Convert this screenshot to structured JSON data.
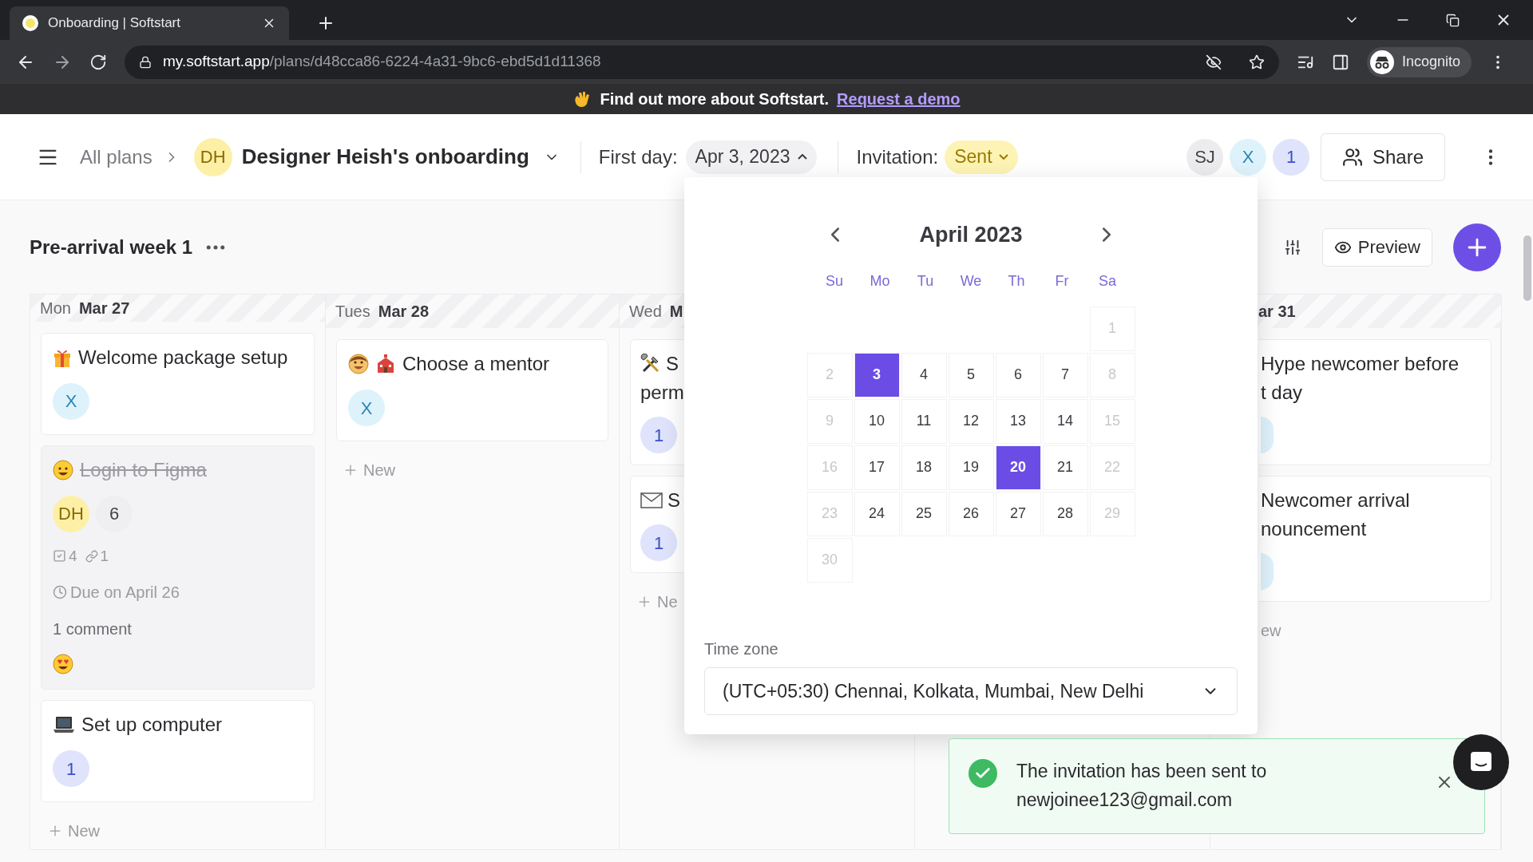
{
  "browser": {
    "tab_title": "Onboarding | Softstart",
    "url_host": "my.softstart.app",
    "url_path": "/plans/d48cca86-6224-4a31-9bc6-ebd5d1d11368",
    "profile": "Incognito"
  },
  "banner": {
    "text": "Find out more about Softstart.",
    "link": "Request a demo"
  },
  "header": {
    "breadcrumb": "All plans",
    "plan_avatar": "DH",
    "plan_title": "Designer Heish's onboarding",
    "first_day_label": "First day:",
    "first_day": "Apr 3, 2023",
    "invitation_label": "Invitation:",
    "invitation": "Sent",
    "members": [
      {
        "initials": "SJ",
        "color": "#ececee"
      },
      {
        "initials": "X",
        "color": "#def2fb"
      },
      {
        "initials": "1",
        "color": "#dfe3fb"
      }
    ],
    "share": "Share"
  },
  "board": {
    "title": "Pre-arrival week 1",
    "preview": "Preview",
    "columns": [
      {
        "day": "Mon",
        "date": "Mar 27",
        "cut_left": false,
        "cut_right": false,
        "new_label": "New",
        "cards": [
          {
            "title": "Welcome package setup",
            "done": false,
            "assignees": [
              {
                "initials": "X",
                "color": "#def2fb"
              }
            ]
          },
          {
            "title": "Login to Figma",
            "done": true,
            "assignees": [
              {
                "initials": "DH",
                "color": "#fdf0a6"
              },
              {
                "initials": "6",
                "color": "#efeff1"
              }
            ],
            "checklist": "4",
            "links": "1",
            "due": "Due on April 26",
            "comments": "1 comment"
          },
          {
            "title": "Set up computer",
            "done": false,
            "assignees": [
              {
                "initials": "1",
                "color": "#dfe3fb"
              }
            ]
          }
        ]
      },
      {
        "day": "Tues",
        "date": "Mar 28",
        "cut_left": false,
        "cut_right": false,
        "new_label": "New",
        "cards": [
          {
            "title": "Choose a mentor",
            "done": false,
            "assignees": [
              {
                "initials": "X",
                "color": "#def2fb"
              }
            ]
          }
        ]
      },
      {
        "day": "Wed",
        "date": "M",
        "cut_left": false,
        "cut_right": true,
        "new_label": "Ne",
        "cards": [
          {
            "lines": [
              "S",
              "perm"
            ],
            "assignees": [
              {
                "initials": "1",
                "color": "#dfe3fb"
              }
            ]
          },
          {
            "lines": [
              "S"
            ],
            "assignees": [
              {
                "initials": "1",
                "color": "#dfe3fb"
              }
            ]
          }
        ]
      },
      {
        "date": "ar 31",
        "cut_left": true,
        "cut_right": false,
        "new_label": "ew",
        "cards": [
          {
            "lines": [
              "Hype newcomer before",
              "t day"
            ],
            "assignees": [
              {
                "color": "#def2fb"
              }
            ]
          },
          {
            "lines": [
              "Newcomer arrival",
              "nouncement"
            ],
            "assignees": [
              {
                "color": "#def2fb"
              }
            ]
          }
        ]
      }
    ]
  },
  "calendar": {
    "month": "April 2023",
    "weekdays": [
      "Su",
      "Mo",
      "Tu",
      "We",
      "Th",
      "Fr",
      "Sa"
    ],
    "weeks": [
      [
        {
          "day": "1",
          "disabled": true,
          "selected": false
        }
      ],
      [
        {
          "day": "2",
          "disabled": true,
          "selected": false
        },
        {
          "day": "3",
          "disabled": false,
          "selected": true
        },
        {
          "day": "4",
          "disabled": false,
          "selected": false
        },
        {
          "day": "5",
          "disabled": false,
          "selected": false
        },
        {
          "day": "6",
          "disabled": false,
          "selected": false
        },
        {
          "day": "7",
          "disabled": false,
          "selected": false
        },
        {
          "day": "8",
          "disabled": true,
          "selected": false
        }
      ],
      [
        {
          "day": "9",
          "disabled": true,
          "selected": false
        },
        {
          "day": "10",
          "disabled": false,
          "selected": false
        },
        {
          "day": "11",
          "disabled": false,
          "selected": false
        },
        {
          "day": "12",
          "disabled": false,
          "selected": false
        },
        {
          "day": "13",
          "disabled": false,
          "selected": false
        },
        {
          "day": "14",
          "disabled": false,
          "selected": false
        },
        {
          "day": "15",
          "disabled": true,
          "selected": false
        }
      ],
      [
        {
          "day": "16",
          "disabled": true,
          "selected": false
        },
        {
          "day": "17",
          "disabled": false,
          "selected": false
        },
        {
          "day": "18",
          "disabled": false,
          "selected": false
        },
        {
          "day": "19",
          "disabled": false,
          "selected": false
        },
        {
          "day": "20",
          "disabled": false,
          "selected": true
        },
        {
          "day": "21",
          "disabled": false,
          "selected": false
        },
        {
          "day": "22",
          "disabled": true,
          "selected": false
        }
      ],
      [
        {
          "day": "23",
          "disabled": true,
          "selected": false
        },
        {
          "day": "24",
          "disabled": false,
          "selected": false
        },
        {
          "day": "25",
          "disabled": false,
          "selected": false
        },
        {
          "day": "26",
          "disabled": false,
          "selected": false
        },
        {
          "day": "27",
          "disabled": false,
          "selected": false
        },
        {
          "day": "28",
          "disabled": false,
          "selected": false
        },
        {
          "day": "29",
          "disabled": true,
          "selected": false
        }
      ],
      [
        {
          "day": "30",
          "disabled": true,
          "selected": false
        }
      ]
    ],
    "timezone_label": "Time zone",
    "timezone": "(UTC+05:30) Chennai, Kolkata, Mumbai, New Delhi"
  },
  "toast": {
    "message": "The invitation has been sent to newjoinee123@gmail.com"
  }
}
